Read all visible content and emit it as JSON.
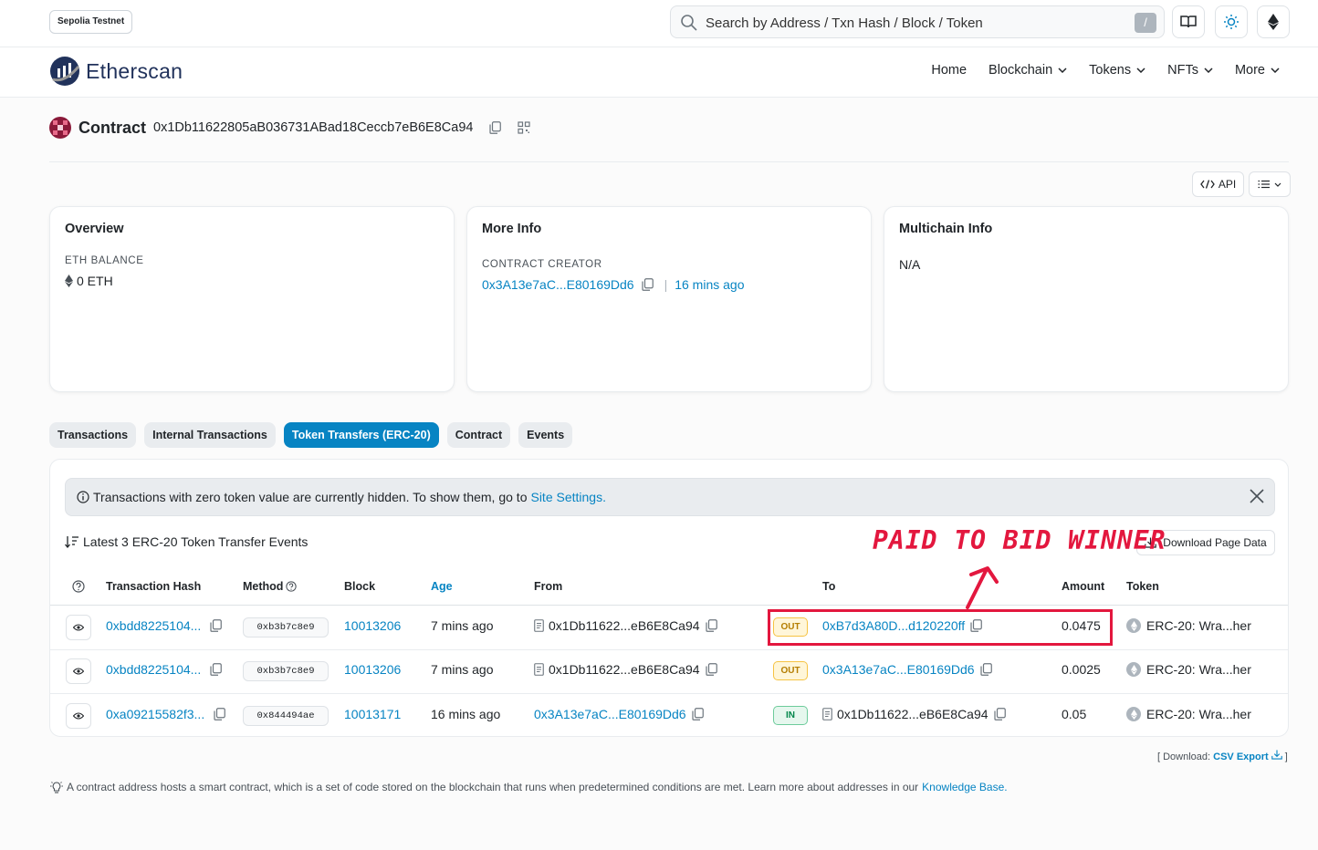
{
  "topbar": {
    "network": "Sepolia Testnet",
    "search_placeholder": "Search by Address / Txn Hash / Block / Token",
    "search_shortcut": "/"
  },
  "nav": {
    "brand": "Etherscan",
    "items": [
      "Home",
      "Blockchain",
      "Tokens",
      "NFTs",
      "More"
    ]
  },
  "contract": {
    "label": "Contract",
    "address": "0x1Db11622805aB036731ABad18Ceccb7eB6E8Ca94",
    "api_label": "API"
  },
  "overview": {
    "title": "Overview",
    "balance_label": "ETH BALANCE",
    "balance_value": "0 ETH"
  },
  "more_info": {
    "title": "More Info",
    "creator_label": "CONTRACT CREATOR",
    "creator_address": "0x3A13e7aC...E80169Dd6",
    "separator": "|",
    "creator_age": "16 mins ago"
  },
  "multichain": {
    "title": "Multichain Info",
    "value": "N/A"
  },
  "tabs": [
    {
      "label": "Transactions",
      "active": false
    },
    {
      "label": "Internal Transactions",
      "active": false
    },
    {
      "label": "Token Transfers (ERC-20)",
      "active": true
    },
    {
      "label": "Contract",
      "active": false
    },
    {
      "label": "Events",
      "active": false
    }
  ],
  "alert": {
    "text": "Transactions with zero token value are currently hidden. To show them, go to",
    "link": "Site Settings."
  },
  "latest_label": "Latest 3 ERC-20 Token Transfer Events",
  "download_label": "Download Page Data",
  "annotation": "PAID TO BID WINNER",
  "table": {
    "headers": {
      "hash": "Transaction Hash",
      "method": "Method",
      "block": "Block",
      "age": "Age",
      "from": "From",
      "to": "To",
      "amount": "Amount",
      "token": "Token"
    },
    "rows": [
      {
        "hash": "0xbdd8225104...",
        "method": "0xb3b7c8e9",
        "block": "10013206",
        "age": "7 mins ago",
        "from": "0x1Db11622...eB6E8Ca94",
        "direction": "OUT",
        "to": "0xB7d3A80D...d120220ff",
        "amount": "0.0475",
        "token": "ERC-20: Wra...her"
      },
      {
        "hash": "0xbdd8225104...",
        "method": "0xb3b7c8e9",
        "block": "10013206",
        "age": "7 mins ago",
        "from": "0x1Db11622...eB6E8Ca94",
        "direction": "OUT",
        "to": "0x3A13e7aC...E80169Dd6",
        "amount": "0.0025",
        "token": "ERC-20: Wra...her"
      },
      {
        "hash": "0xa09215582f3...",
        "method": "0x844494ae",
        "block": "10013171",
        "age": "16 mins ago",
        "from": "0x3A13e7aC...E80169Dd6",
        "direction": "IN",
        "to": "0x1Db11622...eB6E8Ca94",
        "amount": "0.05",
        "token": "ERC-20: Wra...her"
      }
    ]
  },
  "footer": {
    "download_prefix": "[ Download:",
    "download_link": "CSV Export",
    "download_suffix": "]",
    "note": "A contract address hosts a smart contract, which is a set of code stored on the blockchain that runs when predetermined conditions are met. Learn more about addresses in our",
    "note_link": "Knowledge Base."
  },
  "colors": {
    "link": "#0784c3",
    "annotation": "#e3173e",
    "tab_active": "#0784c3"
  }
}
